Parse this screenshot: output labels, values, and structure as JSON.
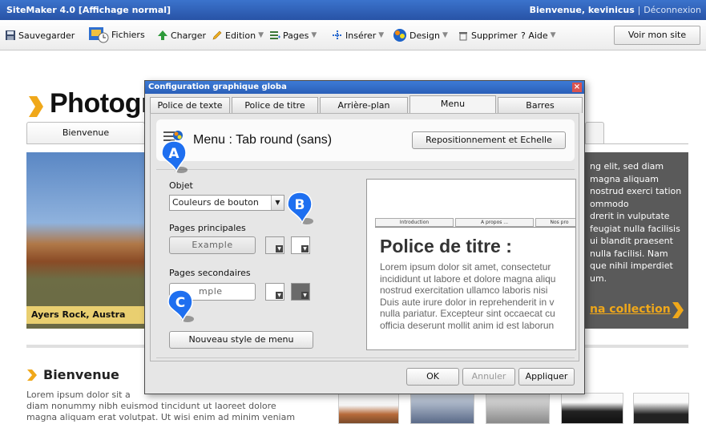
{
  "topbar": {
    "app_title": "SiteMaker 4.0  [Affichage normal]",
    "welcome": "Bienvenue, kevinicus",
    "separator": "|",
    "logout": "Déconnexion"
  },
  "toolbar": {
    "save": "Sauvegarder",
    "files": "Fichiers",
    "upload": "Charger",
    "edit": "Edition",
    "pages": "Pages",
    "insert": "Insérer",
    "design": "Design",
    "delete": "Supprimer",
    "help": "? Aide",
    "view_site": "Voir mon site"
  },
  "site": {
    "title": "Photogr",
    "tab_home": "Bienvenue",
    "photo_caption": "Ayers Rock, Austra",
    "banner_lines": [
      "ng elit, sed diam",
      "magna aliquam",
      "nostrud exerci tation",
      "ommodo",
      "drerit in vulputate",
      "feugiat nulla facilisis",
      "ui blandit praesent",
      "nulla facilisi. Nam",
      "que nihil imperdiet",
      "um."
    ],
    "banner_link": "na collection",
    "section_title": "Bienvenue",
    "section_lines": [
      "Lorem ipsum dolor sit a",
      "diam nonummy nibh euismod tincidunt ut laoreet dolore",
      "magna aliquam erat volutpat. Ut wisi enim ad minim veniam"
    ]
  },
  "modal": {
    "title": "Configuration graphique globa",
    "close": "×",
    "tabs": [
      "Police de texte",
      "Police de titre",
      "Arrière-plan",
      "Menu",
      "Barres"
    ],
    "active_tab": "Menu",
    "header_title": "Menu : Tab round (sans)",
    "reposition_button": "Repositionnement et Echelle",
    "object_label": "Objet",
    "object_select": "Couleurs de bouton",
    "main_pages_label": "Pages principales",
    "example_button": "Example",
    "secondary_pages_label": "Pages secondaires",
    "secondary_example": "mple",
    "new_style_button": "Nouveau style de menu",
    "ok": "OK",
    "cancel": "Annuler",
    "apply": "Appliquer",
    "preview": {
      "tabs": [
        "Introduction",
        "A propos ...",
        "Nos pro"
      ],
      "title": "Police de titre :",
      "body_lines": [
        "Lorem ipsum dolor sit amet, consectetur",
        "incididunt ut labore et dolore magna aliqu",
        "nostrud exercitation ullamco laboris nisi",
        "Duis aute irure dolor in reprehenderit in v",
        "nulla pariatur. Excepteur sint occaecat cu",
        "officia deserunt mollit anim id est laborun"
      ]
    }
  },
  "callouts": [
    "A",
    "B",
    "C"
  ],
  "colors": {
    "topbar": "#2a5fb8",
    "accent": "#f0a81a",
    "callout": "#1e6ff0",
    "banner": "#5a5a5a"
  }
}
